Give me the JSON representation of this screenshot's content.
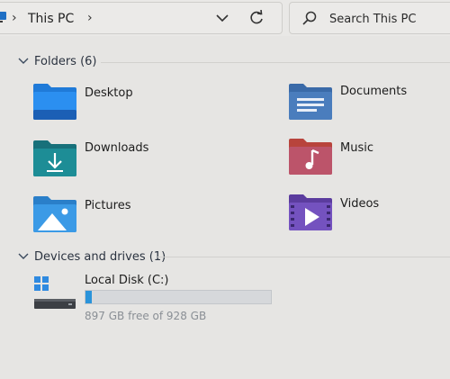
{
  "address_bar": {
    "location_icon": "this-pc-monitor-icon",
    "separator": "›",
    "crumb": "This PC",
    "trailing_chevron": "›"
  },
  "search": {
    "placeholder": "Search This PC"
  },
  "folders_section": {
    "title": "Folders (6)",
    "items": [
      {
        "label": "Desktop",
        "icon": "desktop-folder-icon"
      },
      {
        "label": "Documents",
        "icon": "documents-folder-icon"
      },
      {
        "label": "Downloads",
        "icon": "downloads-folder-icon"
      },
      {
        "label": "Music",
        "icon": "music-folder-icon"
      },
      {
        "label": "Pictures",
        "icon": "pictures-folder-icon"
      },
      {
        "label": "Videos",
        "icon": "videos-folder-icon"
      }
    ]
  },
  "drives_section": {
    "title": "Devices and drives (1)",
    "drives": [
      {
        "label": "Local Disk (C:)",
        "free_text": "897 GB free of 928 GB",
        "used_fraction": 0.033,
        "icon": "local-disk-windows-icon"
      }
    ]
  },
  "colors": {
    "accent": "#2a93da",
    "background": "#e6e5e3"
  }
}
